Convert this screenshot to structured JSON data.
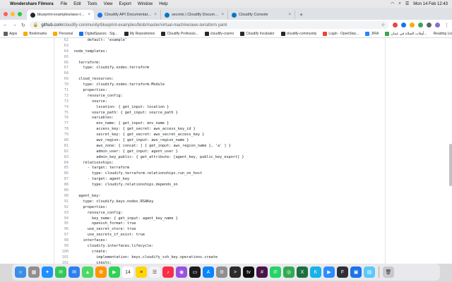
{
  "menubar": {
    "app_name": "Wondershare Filmora",
    "items": [
      "File",
      "Edit",
      "Tools",
      "View",
      "Export",
      "Window",
      "Help"
    ],
    "clock": "Mon 14 Feb  12:43"
  },
  "tabs": [
    {
      "title": "blueprint-examples/aws-terra",
      "color": "#24292f",
      "active": true
    },
    {
      "title": "Cloudify API Documentation",
      "color": "#1a73e8",
      "active": false
    },
    {
      "title": "secrets | Cloudify Documentati",
      "color": "#0077c8",
      "active": false
    },
    {
      "title": "Cloudify Console",
      "color": "#0077c8",
      "active": false
    }
  ],
  "address": {
    "host": "github.com",
    "path": "/cloudify-community/blueprint-examples/blob/master/virtual-machine/aws-terraform.yaml"
  },
  "bookmarks": [
    {
      "label": "Apps",
      "color": "#5f6368"
    },
    {
      "label": "Bookmarks",
      "color": "#f9ab00"
    },
    {
      "label": "Personal",
      "color": "#f9ab00"
    },
    {
      "label": "DigitalSpaces · Sig...",
      "color": "#1a73e8"
    },
    {
      "label": "My Repositories",
      "color": "#24292f"
    },
    {
      "label": "Cloudify Professio...",
      "color": "#24292f"
    },
    {
      "label": "cloudify-cosmo",
      "color": "#24292f"
    },
    {
      "label": "Cloudify Incubator",
      "color": "#24292f"
    },
    {
      "label": "cloudify-community",
      "color": "#24292f"
    },
    {
      "label": "Login - OpenStac...",
      "color": "#e8453c"
    },
    {
      "label": "JIRA",
      "color": "#2684ff"
    },
    {
      "label": "أوقات الصلاة في عمان...",
      "color": "#34a853"
    }
  ],
  "reading_list": "Reading List",
  "code_lines": [
    {
      "n": "62",
      "t": "      default: 'example'"
    },
    {
      "n": "63",
      "t": ""
    },
    {
      "n": "64",
      "t": "node_templates:"
    },
    {
      "n": "65",
      "t": ""
    },
    {
      "n": "66",
      "t": "  terraform:"
    },
    {
      "n": "67",
      "t": "    type: cloudify.nodes.terraform"
    },
    {
      "n": "68",
      "t": ""
    },
    {
      "n": "69",
      "t": "  cloud_resources:"
    },
    {
      "n": "70",
      "t": "    type: cloudify.nodes.terraform.Module"
    },
    {
      "n": "71",
      "t": "    properties:"
    },
    {
      "n": "72",
      "t": "      resource_config:"
    },
    {
      "n": "73",
      "t": "        source:"
    },
    {
      "n": "74",
      "t": "          location: { get_input: location }"
    },
    {
      "n": "75",
      "t": "        source_path: { get_input: source_path }"
    },
    {
      "n": "76",
      "t": "        variables:"
    },
    {
      "n": "77",
      "t": "          env_name: { get_input: env_name }"
    },
    {
      "n": "78",
      "t": "          access_key: { get_secret: aws_access_key_id }"
    },
    {
      "n": "79",
      "t": "          secret_key: { get_secret: aws_secret_access_key }"
    },
    {
      "n": "80",
      "t": "          aws_region: { get_input: aws_region_name }"
    },
    {
      "n": "81",
      "t": "          aws_zone: { concat: [ { get_input: aws_region_name }, 'a' ] }"
    },
    {
      "n": "82",
      "t": "          admin_user: { get_input: agent_user }"
    },
    {
      "n": "83",
      "t": "          admin_key_public: { get_attribute: [agent_key, public_key_export] }"
    },
    {
      "n": "84",
      "t": "    relationships:"
    },
    {
      "n": "85",
      "t": "      - target: terraform"
    },
    {
      "n": "86",
      "t": "        type: cloudify.terraform.relationships.run_on_host"
    },
    {
      "n": "87",
      "t": "      - target: agent_key"
    },
    {
      "n": "88",
      "t": "        type: cloudify.relationships.depends_on"
    },
    {
      "n": "89",
      "t": ""
    },
    {
      "n": "90",
      "t": "  agent_key:"
    },
    {
      "n": "91",
      "t": "    type: cloudify.keys.nodes.RSAKey"
    },
    {
      "n": "92",
      "t": "    properties:"
    },
    {
      "n": "93",
      "t": "      resource_config:"
    },
    {
      "n": "94",
      "t": "        key_name: { get_input: agent_key_name }"
    },
    {
      "n": "95",
      "t": "        openssh_format: true"
    },
    {
      "n": "96",
      "t": "      use_secret_store: true"
    },
    {
      "n": "97",
      "t": "      use_secrets_if_exist: true"
    },
    {
      "n": "98",
      "t": "    interfaces:"
    },
    {
      "n": "99",
      "t": "      cloudify.interfaces.lifecycle:"
    },
    {
      "n": "100",
      "t": "        create:"
    },
    {
      "n": "101",
      "t": "          implementation: keys.cloudify_ssh_key.operations.create"
    },
    {
      "n": "102",
      "t": "          inputs:"
    },
    {
      "n": "103",
      "t": "            store_private_key_material: true"
    }
  ],
  "dock": [
    {
      "name": "finder",
      "color": "#3a8ee6",
      "glyph": "☺"
    },
    {
      "name": "launchpad",
      "color": "#8e8e93",
      "glyph": "▦"
    },
    {
      "name": "safari",
      "color": "#1e90ff",
      "glyph": "✦"
    },
    {
      "name": "messages",
      "color": "#34c759",
      "glyph": "✉"
    },
    {
      "name": "mail",
      "color": "#2f80ed",
      "glyph": "✉"
    },
    {
      "name": "maps",
      "color": "#4cd964",
      "glyph": "▲"
    },
    {
      "name": "photos",
      "color": "#ff9500",
      "glyph": "✿"
    },
    {
      "name": "facetime",
      "color": "#30d158",
      "glyph": "▶"
    },
    {
      "name": "calendar",
      "color": "#ffffff",
      "glyph": "14"
    },
    {
      "name": "notes",
      "color": "#ffd60a",
      "glyph": "≡"
    },
    {
      "name": "reminders",
      "color": "#f2f2f7",
      "glyph": "☰"
    },
    {
      "name": "music",
      "color": "#fa2d48",
      "glyph": "♪"
    },
    {
      "name": "podcasts",
      "color": "#9b51e0",
      "glyph": "◉"
    },
    {
      "name": "tv",
      "color": "#1c1c1e",
      "glyph": "▭"
    },
    {
      "name": "app-store",
      "color": "#0a84ff",
      "glyph": "A"
    },
    {
      "name": "system-preferences",
      "color": "#8e8e93",
      "glyph": "⚙"
    },
    {
      "name": "terminal",
      "color": "#2b2b2b",
      "glyph": ">"
    },
    {
      "name": "apple-tv",
      "color": "#111111",
      "glyph": "tv"
    },
    {
      "name": "slack",
      "color": "#4a154b",
      "glyph": "#"
    },
    {
      "name": "whatsapp",
      "color": "#25d366",
      "glyph": "✆"
    },
    {
      "name": "chrome",
      "color": "#34a853",
      "glyph": "◎"
    },
    {
      "name": "excel",
      "color": "#1d6f42",
      "glyph": "X"
    },
    {
      "name": "kodi",
      "color": "#17b2e7",
      "glyph": "K"
    },
    {
      "name": "zoom",
      "color": "#2d8cff",
      "glyph": "▶"
    },
    {
      "name": "filmora",
      "color": "#2e2e38",
      "glyph": "F"
    },
    {
      "name": "photo-viewer",
      "color": "#1a73e8",
      "glyph": "▣"
    },
    {
      "name": "preview",
      "color": "#5ac8fa",
      "glyph": "▤"
    },
    {
      "name": "trash",
      "color": "#c7c7cc",
      "glyph": "🗑"
    }
  ]
}
